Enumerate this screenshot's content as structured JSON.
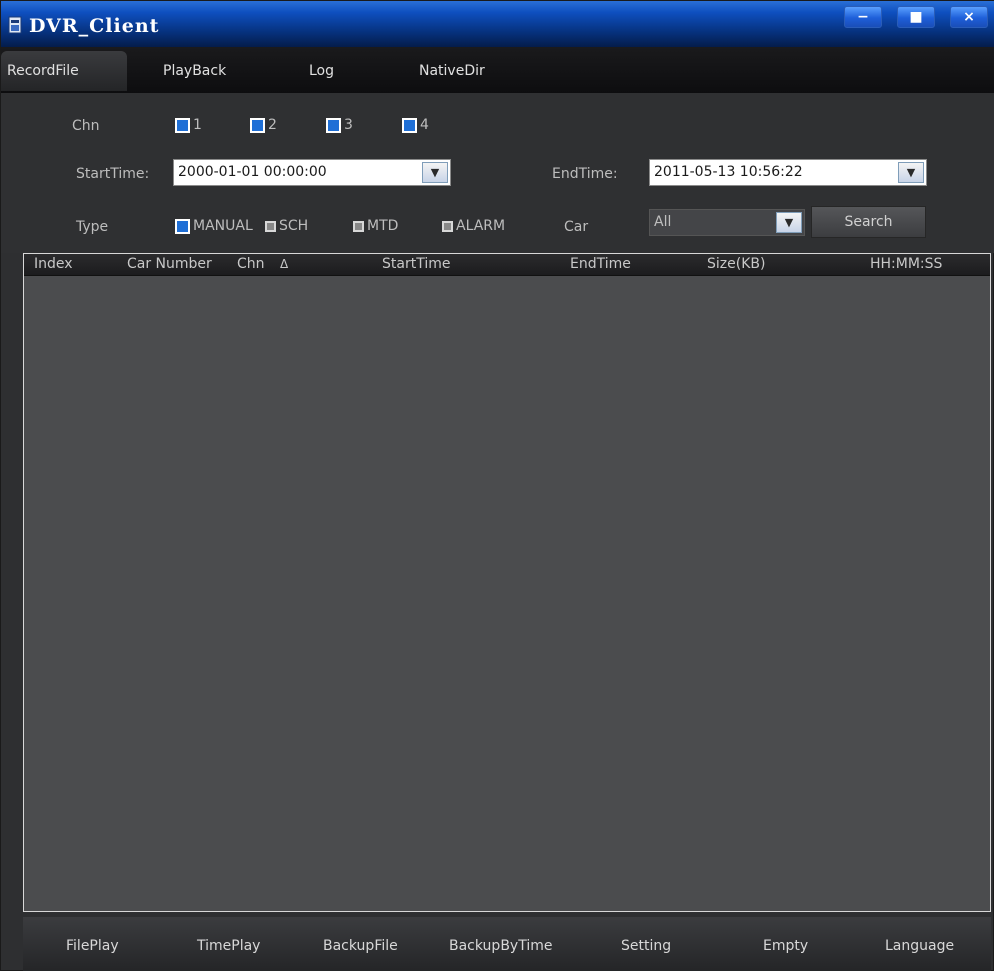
{
  "window": {
    "title": "DVR_Client",
    "minimize_glyph": "−",
    "maximize_glyph": "■",
    "close_glyph": "×"
  },
  "tabs": [
    {
      "label": "RecordFile",
      "active": true
    },
    {
      "label": "PlayBack",
      "active": false
    },
    {
      "label": "Log",
      "active": false
    },
    {
      "label": "NativeDir",
      "active": false
    }
  ],
  "filter": {
    "chn_label": "Chn",
    "channels": [
      {
        "label": "1",
        "checked": true
      },
      {
        "label": "2",
        "checked": true
      },
      {
        "label": "3",
        "checked": true
      },
      {
        "label": "4",
        "checked": true
      }
    ],
    "start_label": "StartTime:",
    "start_value": "2000-01-01 00:00:00",
    "end_label": "EndTime:",
    "end_value": "2011-05-13 10:56:22",
    "type_label": "Type",
    "types": [
      {
        "label": "MANUAL",
        "checked": true
      },
      {
        "label": "SCH",
        "checked": false
      },
      {
        "label": "MTD",
        "checked": false
      },
      {
        "label": "ALARM",
        "checked": false
      }
    ],
    "car_label": "Car",
    "car_value": "All",
    "search_label": "Search"
  },
  "table": {
    "columns": [
      "Index",
      "Car Number",
      "Chn",
      "Δ",
      "StartTime",
      "EndTime",
      "Size(KB)",
      "HH:MM:SS"
    ],
    "rows": []
  },
  "bottom_buttons": [
    "FilePlay",
    "TimePlay",
    "BackupFile",
    "BackupByTime",
    "Setting",
    "Empty",
    "Language"
  ],
  "colors": {
    "titlebar": "#0e4fbf",
    "background": "#2e2f31",
    "table_bg": "#4b4c4e",
    "checkbox_blue": "#1f6fd6"
  }
}
